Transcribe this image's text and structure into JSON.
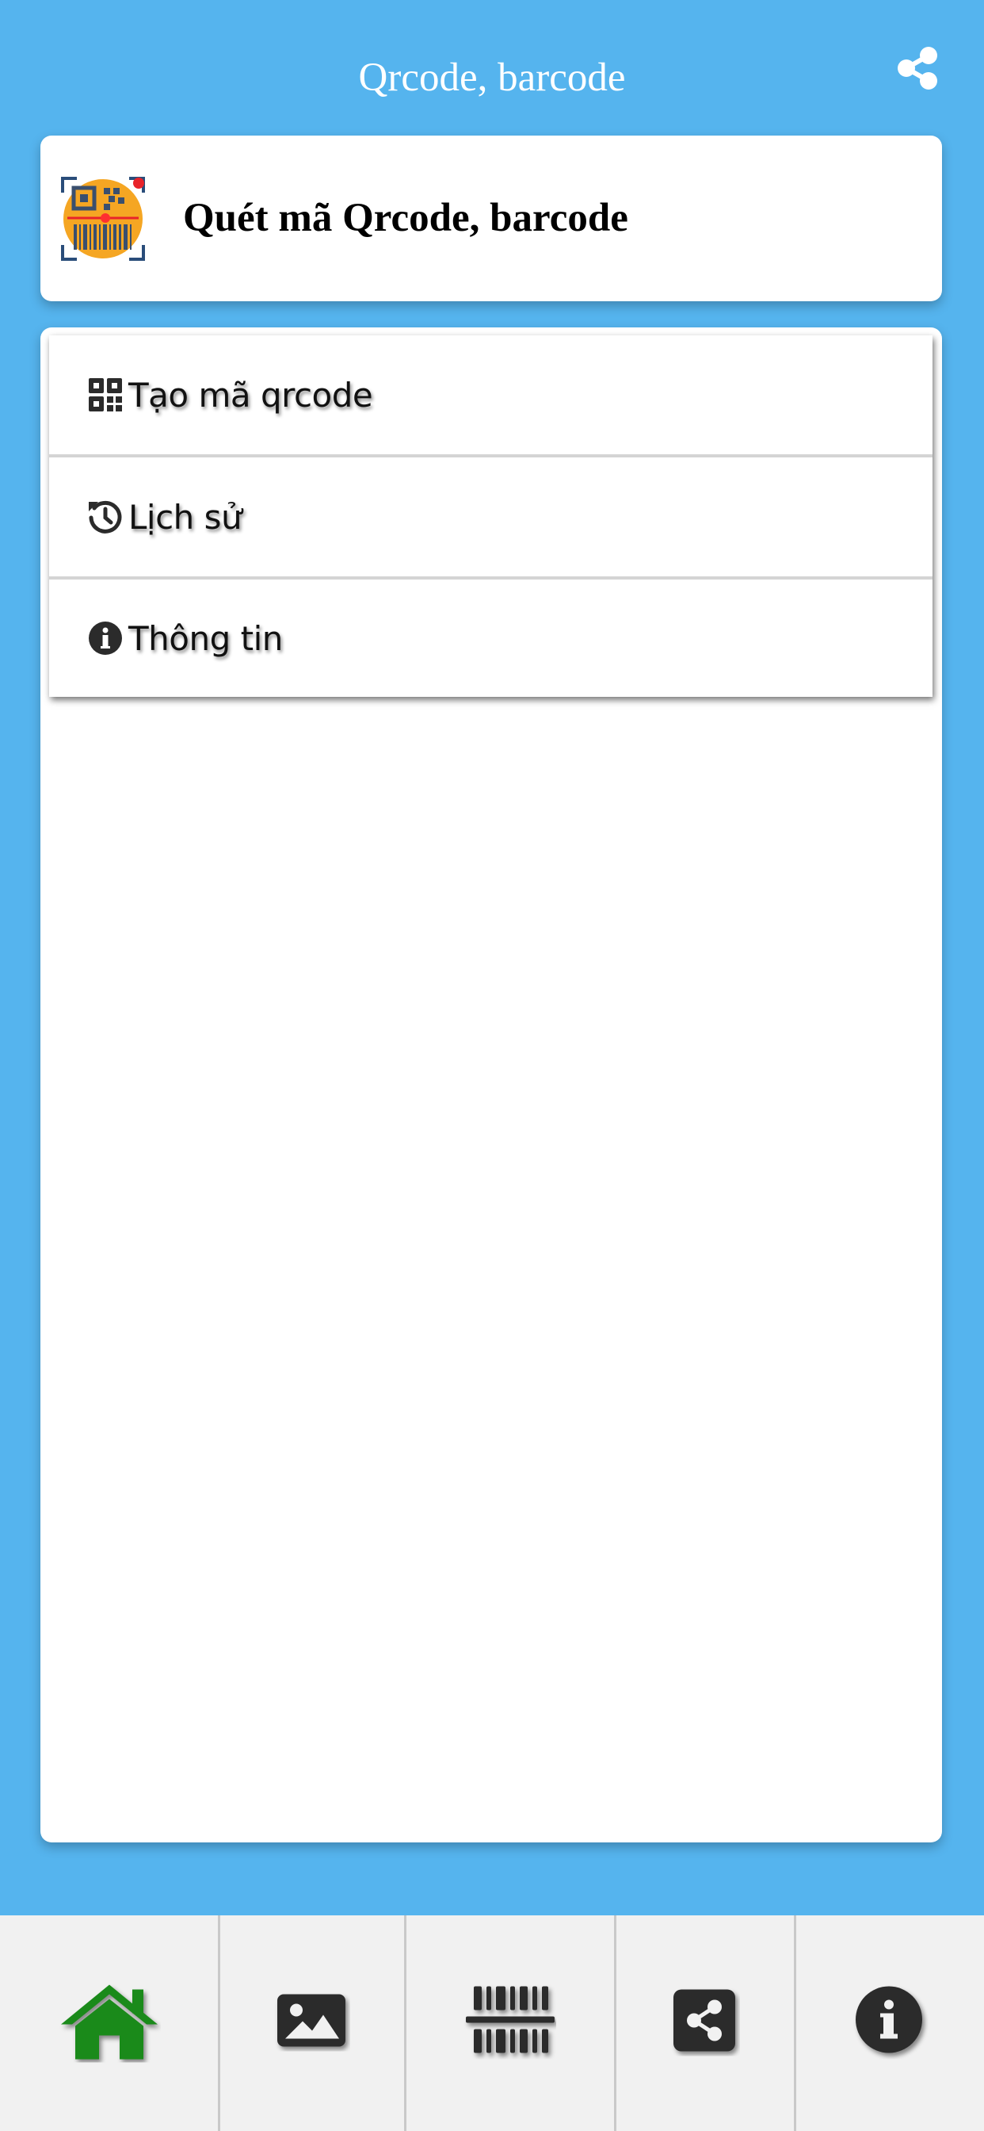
{
  "topbar": {
    "title": "Qrcode, barcode",
    "share_icon": "share-icon"
  },
  "header": {
    "title": "Quét mã Qrcode, barcode",
    "logo_icon": "qr-barcode-scanner-logo"
  },
  "menu": {
    "items": [
      {
        "label": "Tạo mã qrcode",
        "icon": "qrcode-icon"
      },
      {
        "label": "Lịch sử",
        "icon": "history-icon"
      },
      {
        "label": "Thông tin",
        "icon": "info-circle-icon"
      }
    ]
  },
  "bottom_nav": {
    "items": [
      {
        "name": "home",
        "icon": "home-icon",
        "active": true
      },
      {
        "name": "image",
        "icon": "image-icon",
        "active": false
      },
      {
        "name": "scan-barcode",
        "icon": "barcode-scan-icon",
        "active": false
      },
      {
        "name": "share",
        "icon": "share-square-icon",
        "active": false
      },
      {
        "name": "info",
        "icon": "info-circle-icon",
        "active": false
      }
    ]
  },
  "colors": {
    "background": "#55b4ee",
    "card": "#ffffff",
    "nav_background": "#f1f1f1",
    "active_icon": "#1a8a1a",
    "icon_dark": "#2b2b2b"
  }
}
